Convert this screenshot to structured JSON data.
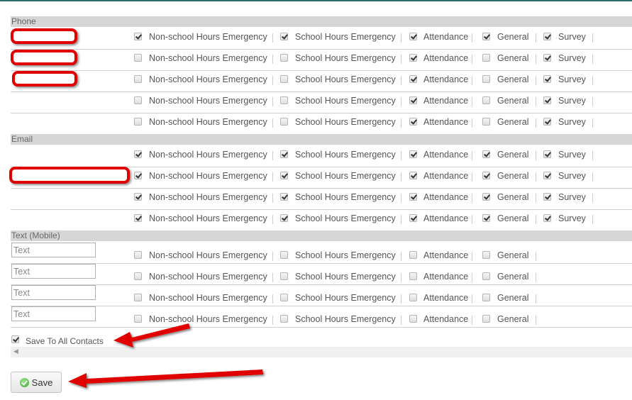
{
  "sections": [
    {
      "title": "Phone",
      "rows": [
        {
          "redacted": true,
          "options": [
            true,
            true,
            true,
            true,
            true
          ]
        },
        {
          "redacted": true,
          "options": [
            false,
            false,
            true,
            false,
            true
          ]
        },
        {
          "redacted": true,
          "options": [
            false,
            false,
            true,
            false,
            true
          ]
        },
        {
          "redacted": false,
          "options": [
            false,
            false,
            true,
            false,
            true
          ]
        },
        {
          "redacted": false,
          "options": [
            false,
            false,
            true,
            false,
            true
          ]
        }
      ]
    },
    {
      "title": "Email",
      "rows": [
        {
          "redacted": false,
          "options": [
            true,
            true,
            true,
            true,
            true
          ]
        },
        {
          "redacted": true,
          "options": [
            true,
            true,
            true,
            true,
            true
          ]
        },
        {
          "redacted": false,
          "options": [
            true,
            true,
            true,
            true,
            true
          ]
        },
        {
          "redacted": false,
          "options": [
            true,
            true,
            true,
            true,
            true
          ]
        }
      ]
    },
    {
      "title": "Text (Mobile)",
      "rows": [
        {
          "input_placeholder": "Text",
          "options": [
            false,
            false,
            false,
            false
          ]
        },
        {
          "input_placeholder": "Text",
          "options": [
            false,
            false,
            false,
            false
          ]
        },
        {
          "input_placeholder": "Text",
          "options": [
            false,
            false,
            false,
            false
          ]
        },
        {
          "input_placeholder": "Text",
          "options": [
            false,
            false,
            false,
            false
          ]
        }
      ]
    }
  ],
  "option_labels": [
    "Non-school Hours Emergency",
    "School Hours Emergency",
    "Attendance",
    "General",
    "Survey"
  ],
  "save_all": {
    "label": "Save To All Contacts",
    "checked": true
  },
  "save_button": {
    "label": "Save"
  },
  "colors": {
    "header_bg": "#d6d6d6",
    "annotation_red": "#e00000",
    "top_bar": "#2e6b6b"
  }
}
